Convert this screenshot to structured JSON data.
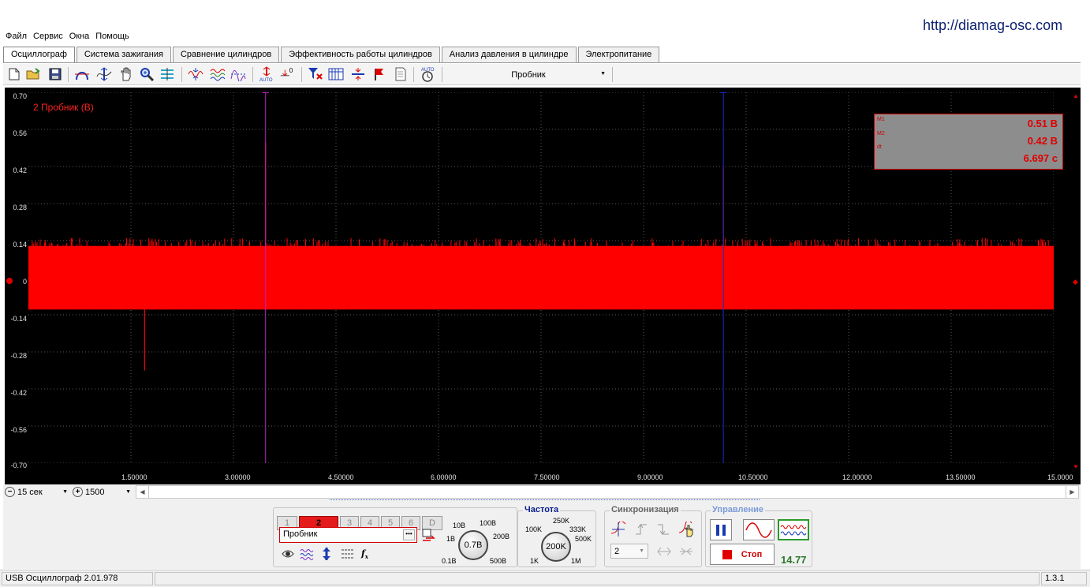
{
  "url": "http://diamag-osc.com",
  "menu": [
    "Файл",
    "Сервис",
    "Окна",
    "Помощь"
  ],
  "tabs": [
    "Осциллограф",
    "Система зажигания",
    "Сравнение цилиндров",
    "Эффективность работы цилиндров",
    "Анализ давления в цилиндре",
    "Электропитание"
  ],
  "active_tab": "Осциллограф",
  "toolbar": {
    "probe_select": "Пробник",
    "icons": [
      "new-file-icon",
      "open-folder-icon",
      "save-icon",
      "cursor-horizontal-icon",
      "cursor-vertical-icon",
      "hand-pan-icon",
      "zoom-icon",
      "grid-view-icon",
      "expand-waves-icon",
      "multi-wave-icon",
      "wave-compare-icon",
      "auto-scale-icon",
      "zero-offset-icon",
      "filter-icon",
      "table-icon",
      "split-icon",
      "marker-flag-icon",
      "notes-icon",
      "auto-trigger-icon"
    ]
  },
  "channel_title": "2 Пробник (В)",
  "measurements": [
    {
      "label": "M1",
      "value": "0.51 В"
    },
    {
      "label": "M2",
      "value": "0.42 В"
    },
    {
      "label": "dt",
      "value": "6.697 с"
    }
  ],
  "markers": [
    {
      "label": "1",
      "x": 3.47,
      "color": "#c020c0",
      "peak": 0.51
    },
    {
      "label": "2",
      "x": 10.167,
      "color": "#1030d0",
      "peak": 0.42
    }
  ],
  "chart_data": {
    "type": "line",
    "title": "2 Пробник (В)",
    "xlim": [
      0,
      15.0
    ],
    "ylim": [
      -0.7,
      0.7
    ],
    "y_ticks": [
      "0.70",
      "0.56",
      "0.42",
      "0.28",
      "0.14",
      "0",
      "-0.14",
      "-0.28",
      "-0.42",
      "-0.56",
      "-0.70"
    ],
    "x_ticks": [
      "1.50000",
      "3.00000",
      "4.50000",
      "6.00000",
      "7.50000",
      "9.00000",
      "10.50000",
      "12.00000",
      "13.50000",
      "15.0000"
    ],
    "x_tick_values": [
      1.5,
      3.0,
      4.5,
      6.0,
      7.5,
      9.0,
      10.5,
      12.0,
      13.5,
      15.0
    ],
    "y_tick_values": [
      0.7,
      0.56,
      0.42,
      0.28,
      0.14,
      0,
      -0.14,
      -0.28,
      -0.42,
      -0.56,
      -0.7
    ],
    "grid": true,
    "series": [
      {
        "name": "2 Пробник (В)",
        "color": "#ff0000",
        "band_min": -0.12,
        "band_max": 0.12,
        "spike_max": 0.15,
        "spike_min": -0.16,
        "outliers": [
          {
            "x": 1.7,
            "y": -0.35
          },
          {
            "x": 3.47,
            "y": 0.51
          },
          {
            "x": 10.167,
            "y": 0.42
          }
        ],
        "x_end": 15.0
      }
    ]
  },
  "timebase": {
    "value": "15 сек",
    "points": "1500"
  },
  "channels": [
    "1",
    "2",
    "3",
    "4",
    "5",
    "6",
    "D"
  ],
  "active_channel": "2",
  "probe_field": "Пробник",
  "volt_knob": {
    "value": "0.7В",
    "labels": [
      "10В",
      "100В",
      "1В",
      "200В",
      "0.1В",
      "500В"
    ]
  },
  "freq": {
    "title": "Частота",
    "value": "200K",
    "labels": [
      "250K",
      "100K",
      "333K",
      "500K",
      "1K",
      "1M"
    ]
  },
  "sync": {
    "title": "Синхронизация",
    "channel": "2"
  },
  "control": {
    "title": "Управление",
    "stop_label": "Стоп",
    "value": "14.77"
  },
  "status": {
    "device": "USB Осциллограф  2.01.978",
    "version": "1.3.1"
  },
  "colors": {
    "trace": "#ff0000",
    "background": "#000000",
    "marker1": "#c020c0",
    "marker2": "#1030d0"
  }
}
